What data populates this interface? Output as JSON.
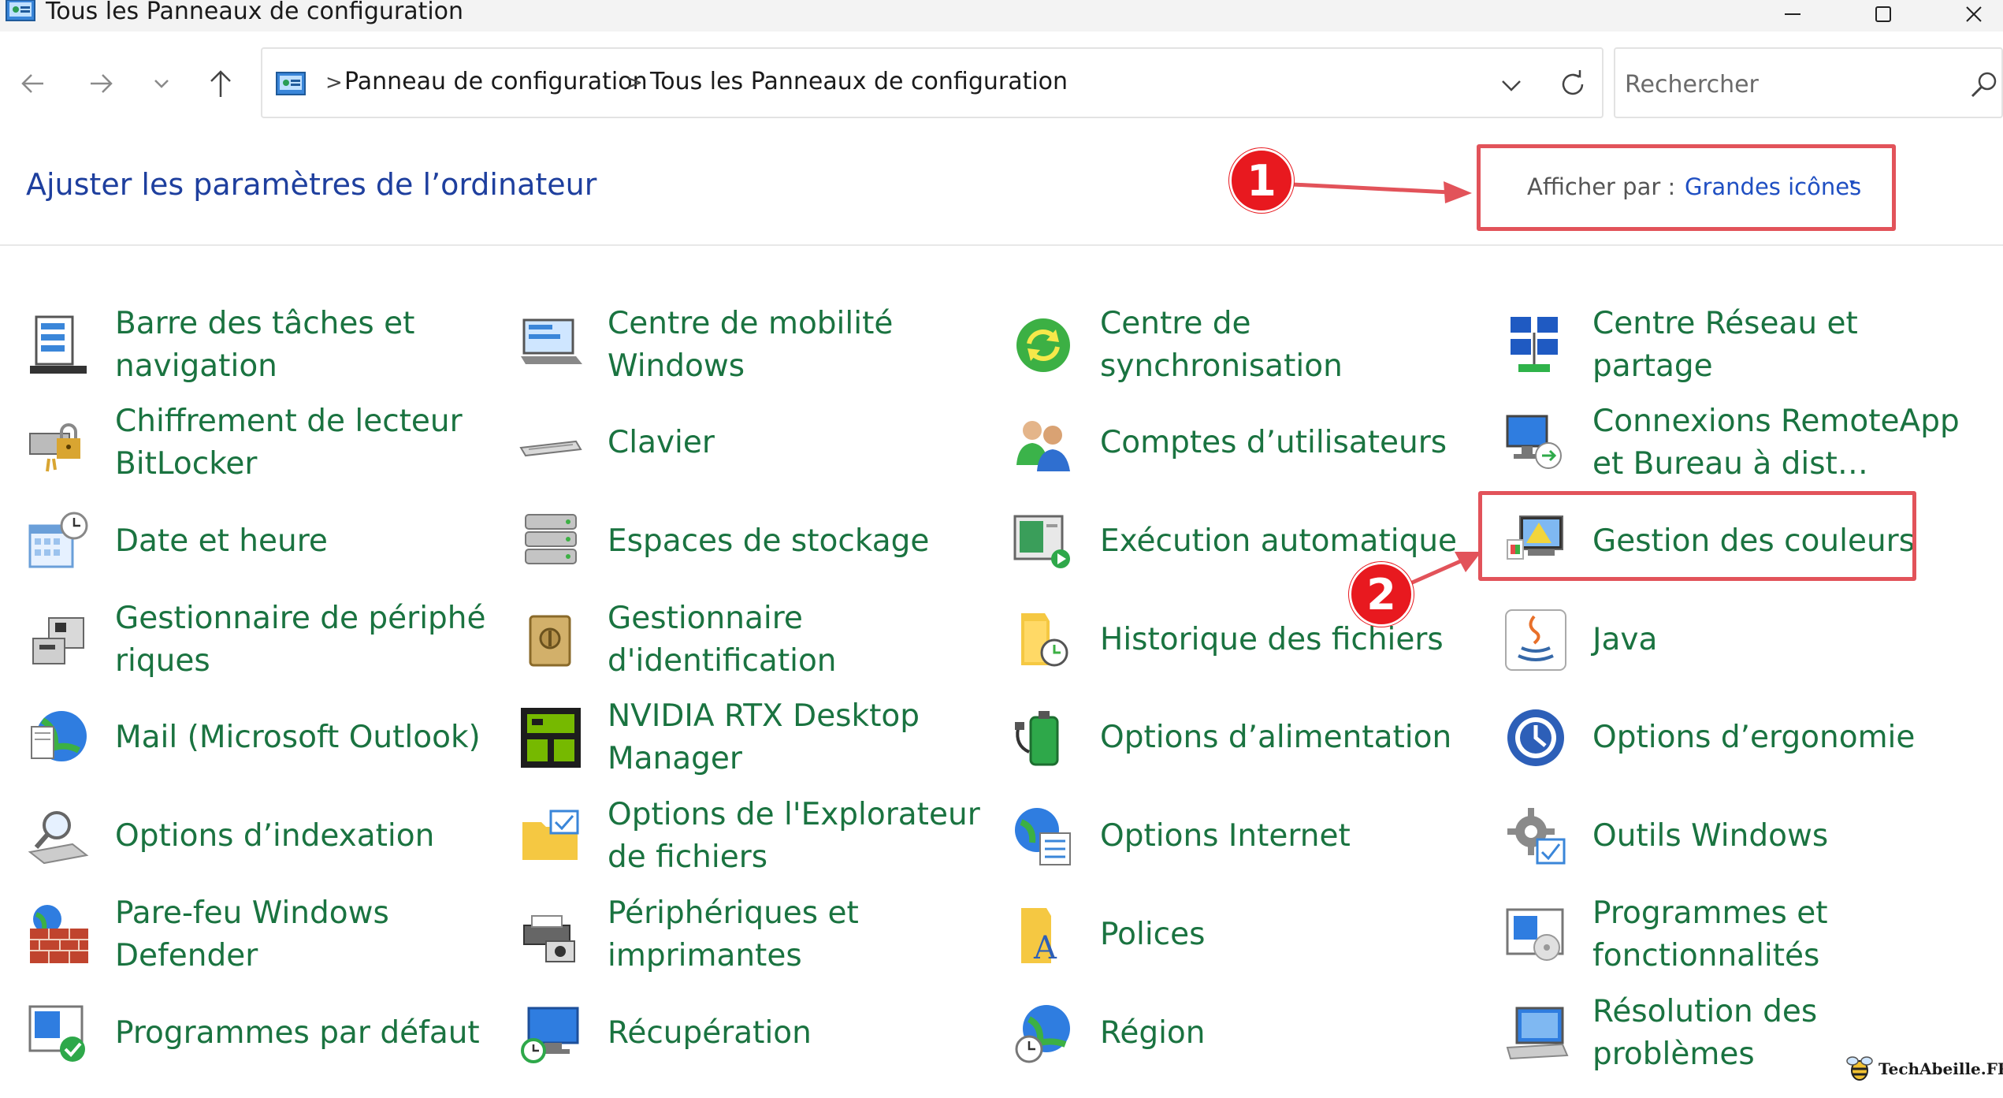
{
  "window": {
    "title": "Tous les Panneaux de configuration",
    "controls": {
      "minimize": "—",
      "maximize": "☐",
      "close": "✕"
    }
  },
  "nav": {
    "breadcrumb": [
      "Panneau de configuration",
      "Tous les Panneaux de configuration"
    ],
    "search_placeholder": "Rechercher"
  },
  "header": {
    "title": "Ajuster les paramètres de l’ordinateur",
    "view_by_label": "Afficher par :",
    "view_by_value": "Grandes icônes"
  },
  "annotations": {
    "badge_1": "1",
    "badge_2": "2"
  },
  "items": [
    {
      "label": "Barre des tâches et navigation",
      "icon": "taskbar-icon"
    },
    {
      "label": "Centre de mobilité Windows",
      "icon": "mobility-center-icon"
    },
    {
      "label": "Centre de synchronisation",
      "icon": "sync-center-icon"
    },
    {
      "label": "Centre Réseau et partage",
      "icon": "network-sharing-icon"
    },
    {
      "label": "Chiffrement de lecteur BitLocker",
      "icon": "bitlocker-icon"
    },
    {
      "label": "Clavier",
      "icon": "keyboard-icon"
    },
    {
      "label": "Comptes d’utilisateurs",
      "icon": "user-accounts-icon"
    },
    {
      "label": "Connexions RemoteApp et Bureau à dist…",
      "icon": "remoteapp-icon"
    },
    {
      "label": "Date et heure",
      "icon": "date-time-icon"
    },
    {
      "label": "Espaces de stockage",
      "icon": "storage-spaces-icon"
    },
    {
      "label": "Exécution automatique",
      "icon": "autoplay-icon"
    },
    {
      "label": "Gestion des couleurs",
      "icon": "color-management-icon"
    },
    {
      "label": "Gestionnaire de périphé riques",
      "icon": "device-manager-icon"
    },
    {
      "label": "Gestionnaire d'identification",
      "icon": "credential-manager-icon"
    },
    {
      "label": "Historique des fichiers",
      "icon": "file-history-icon"
    },
    {
      "label": "Java",
      "icon": "java-icon"
    },
    {
      "label": "Mail (Microsoft Outlook)",
      "icon": "mail-icon"
    },
    {
      "label": "NVIDIA RTX Desktop Manager",
      "icon": "nvidia-icon"
    },
    {
      "label": "Options d’alimentation",
      "icon": "power-options-icon"
    },
    {
      "label": "Options d’ergonomie",
      "icon": "ease-of-access-icon"
    },
    {
      "label": "Options d’indexation",
      "icon": "indexing-options-icon"
    },
    {
      "label": "Options de l'Explorateur de fichiers",
      "icon": "explorer-options-icon"
    },
    {
      "label": "Options Internet",
      "icon": "internet-options-icon"
    },
    {
      "label": "Outils Windows",
      "icon": "windows-tools-icon"
    },
    {
      "label": "Pare-feu Windows Defender",
      "icon": "firewall-icon"
    },
    {
      "label": "Périphériques et imprimantes",
      "icon": "devices-printers-icon"
    },
    {
      "label": "Polices",
      "icon": "fonts-icon"
    },
    {
      "label": "Programmes et fonctionnalités",
      "icon": "programs-features-icon"
    },
    {
      "label": "Programmes par défaut",
      "icon": "default-programs-icon"
    },
    {
      "label": "Récupération",
      "icon": "recovery-icon"
    },
    {
      "label": "Région",
      "icon": "region-icon"
    },
    {
      "label": "Résolution des problèmes",
      "icon": "troubleshooting-icon"
    }
  ],
  "watermark": "TechAbeille.FR",
  "colors": {
    "link_green": "#1a7340",
    "title_blue": "#1e3f9e",
    "highlight_red": "#e2535a",
    "badge_red": "#e8191f"
  }
}
